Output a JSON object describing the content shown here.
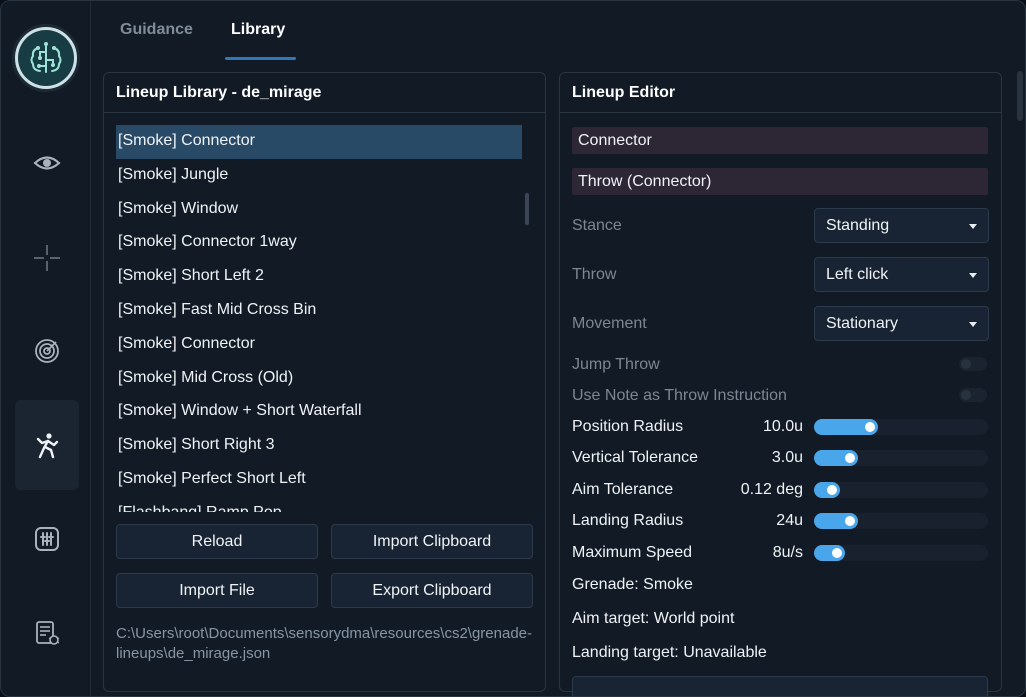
{
  "tabs": [
    {
      "label": "Guidance",
      "active": false
    },
    {
      "label": "Library",
      "active": true
    }
  ],
  "sidebar": {
    "items": [
      {
        "icon": "eye-icon"
      },
      {
        "icon": "crosshair-icon"
      },
      {
        "icon": "radar-icon"
      },
      {
        "icon": "throw-person-icon",
        "active": true
      },
      {
        "icon": "sliders-icon"
      },
      {
        "icon": "document-bug-icon"
      }
    ]
  },
  "library": {
    "title": "Lineup Library - de_mirage",
    "items": [
      "[Smoke] Connector",
      "[Smoke] Jungle",
      "[Smoke] Window",
      "[Smoke] Connector 1way",
      "[Smoke] Short Left 2",
      "[Smoke] Fast Mid Cross Bin",
      "[Smoke] Connector",
      "[Smoke] Mid Cross (Old)",
      "[Smoke] Window + Short Waterfall",
      "[Smoke] Short Right 3",
      "[Smoke] Perfect Short Left",
      "[Flashbang] Ramp Pop"
    ],
    "selected_index": 0,
    "buttons": {
      "reload": "Reload",
      "import_clipboard": "Import Clipboard",
      "import_file": "Import File",
      "export_clipboard": "Export Clipboard"
    },
    "path": "C:\\Users\\root\\Documents\\sensorydma\\resources\\cs2\\grenade-lineups\\de_mirage.json"
  },
  "editor": {
    "title": "Lineup Editor",
    "name_value": "Connector",
    "throw_value": "Throw (Connector)",
    "stance": {
      "label": "Stance",
      "value": "Standing"
    },
    "throw": {
      "label": "Throw",
      "value": "Left click"
    },
    "movement": {
      "label": "Movement",
      "value": "Stationary"
    },
    "jump_throw": {
      "label": "Jump Throw",
      "on": false
    },
    "use_note": {
      "label": "Use Note as Throw Instruction",
      "on": false
    },
    "sliders": [
      {
        "label": "Position Radius",
        "value": "10.0u",
        "fraction": 0.37
      },
      {
        "label": "Vertical Tolerance",
        "value": "3.0u",
        "fraction": 0.25
      },
      {
        "label": "Aim Tolerance",
        "value": "0.12 deg",
        "fraction": 0.15
      },
      {
        "label": "Landing Radius",
        "value": "24u",
        "fraction": 0.25
      },
      {
        "label": "Maximum Speed",
        "value": "8u/s",
        "fraction": 0.18
      }
    ],
    "grenade": "Grenade: Smoke",
    "aim_target": "Aim target: World point",
    "landing_target": "Landing target: Unavailable"
  },
  "colors": {
    "accent": "#4aa6ea",
    "selected_row": "#294a67",
    "tab_underline": "#2f78b9"
  }
}
